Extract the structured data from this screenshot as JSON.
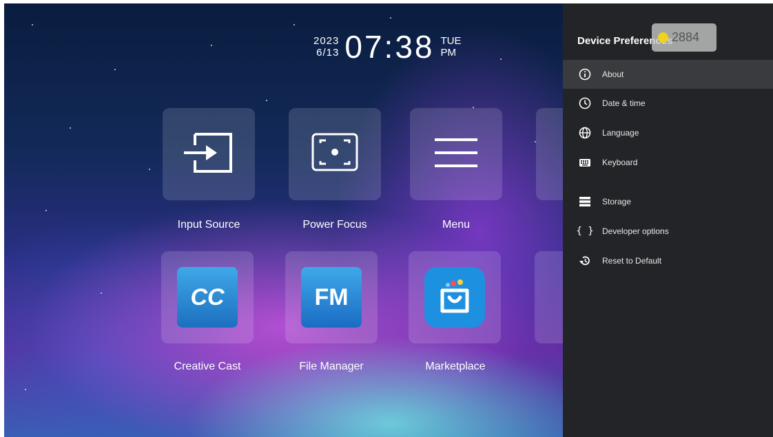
{
  "clock": {
    "year": "2023",
    "date": "6/13",
    "time": "07:38",
    "weekday": "TUE",
    "period": "PM"
  },
  "apps": [
    {
      "label": "Input Source",
      "icon": "input-source-icon"
    },
    {
      "label": "Power Focus",
      "icon": "power-focus-icon"
    },
    {
      "label": "Menu",
      "icon": "menu-icon"
    },
    {
      "label": "Creative Cast",
      "icon": "creative-cast-icon"
    },
    {
      "label": "File Manager",
      "icon": "file-manager-icon"
    },
    {
      "label": "Marketplace",
      "icon": "marketplace-icon"
    }
  ],
  "app_icon_text": {
    "cc": "CC",
    "fm": "FM"
  },
  "panel": {
    "title": "Device Preferences",
    "items": [
      {
        "label": "About",
        "icon": "info-icon",
        "selected": true
      },
      {
        "label": "Date & time",
        "icon": "clock-icon"
      },
      {
        "label": "Language",
        "icon": "globe-icon"
      },
      {
        "label": "Keyboard",
        "icon": "keyboard-icon"
      },
      {
        "label": "Storage",
        "icon": "storage-icon"
      },
      {
        "label": "Developer options",
        "icon": "braces-icon"
      },
      {
        "label": "Reset to Default",
        "icon": "reset-icon"
      }
    ]
  },
  "overlay": {
    "counter": "2884",
    "dot_color": "#f2d21a"
  }
}
